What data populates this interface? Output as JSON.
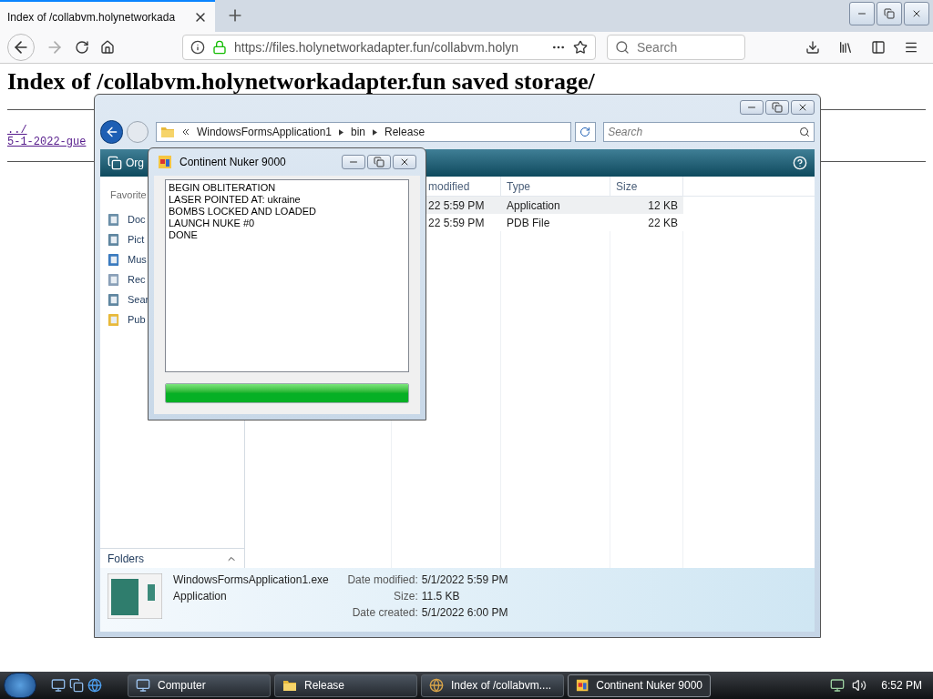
{
  "browser": {
    "tabs": [
      {
        "title": "Index of /collabvm.holynetworkada",
        "selected": true
      }
    ],
    "url": "https://files.holynetworkadapter.fun/collabvm.holyn",
    "search": {
      "placeholder": "Search"
    }
  },
  "page": {
    "heading": "Index of /collabvm.holynetworkadapter.fun saved storage/",
    "links": [
      "../",
      "5-1-2022-gue"
    ]
  },
  "explorer": {
    "breadcrumb": [
      "WindowsFormsApplication1",
      "bin",
      "Release"
    ],
    "search": {
      "placeholder": "Search"
    },
    "toolbar_label": "Org",
    "nav_header": "Favorite",
    "nav_items": [
      {
        "label": "Doc",
        "kind": "documents"
      },
      {
        "label": "Pict",
        "kind": "pictures"
      },
      {
        "label": "Mus",
        "kind": "music"
      },
      {
        "label": "Rec",
        "kind": "recent"
      },
      {
        "label": "Sear",
        "kind": "searches"
      },
      {
        "label": "Pub",
        "kind": "folder"
      }
    ],
    "columns": [
      "modified",
      "Type",
      "Size"
    ],
    "rows": [
      {
        "date": "22 5:59 PM",
        "type": "Application",
        "size": "12 KB",
        "selected": true
      },
      {
        "date": "22 5:59 PM",
        "type": "PDB File",
        "size": "22 KB",
        "selected": false
      }
    ],
    "folders_label": "Folders",
    "details": {
      "name": "WindowsFormsApplication1.exe",
      "type": "Application",
      "fields": [
        {
          "label": "Date modified:",
          "value": "5/1/2022 5:59 PM"
        },
        {
          "label": "Size:",
          "value": "11.5 KB"
        },
        {
          "label": "Date created:",
          "value": "5/1/2022 6:00 PM"
        }
      ]
    }
  },
  "dialog": {
    "title": "Continent Nuker 9000",
    "log": [
      "BEGIN OBLITERATION",
      "LASER POINTED AT: ukraine",
      "BOMBS LOCKED AND LOADED",
      "LAUNCH NUKE #0",
      "DONE"
    ],
    "progress": {
      "level": 1
    }
  },
  "taskbar": {
    "buttons": [
      {
        "label": "Computer",
        "kind": "computer",
        "selected": false
      },
      {
        "label": "Release",
        "kind": "folder",
        "selected": false
      },
      {
        "label": "Index of /collabvm....",
        "kind": "browser",
        "selected": false
      },
      {
        "label": "Continent Nuker 9000",
        "kind": "app",
        "selected": true
      }
    ],
    "time": "6:52 PM"
  }
}
